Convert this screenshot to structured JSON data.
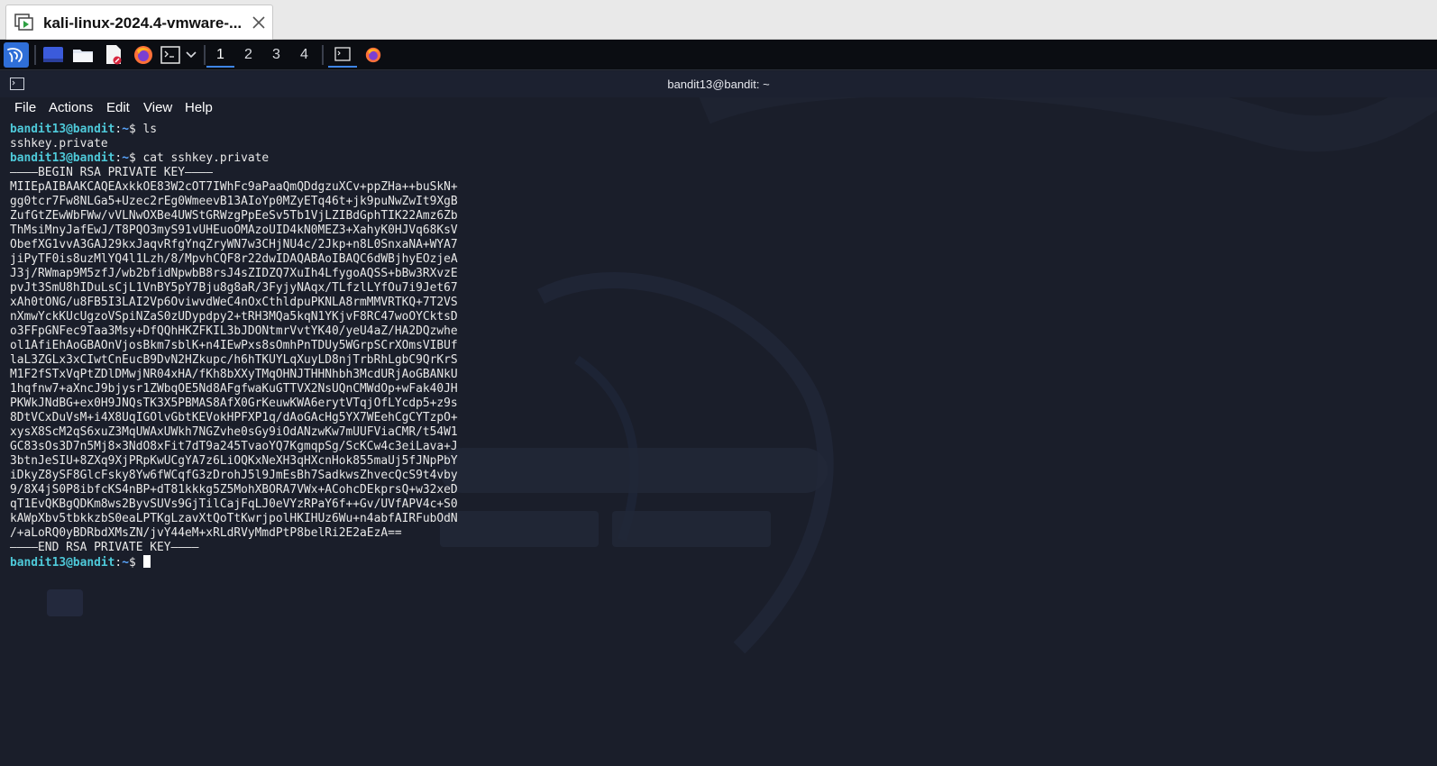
{
  "vmware": {
    "tab_title": "kali-linux-2024.4-vmware-...",
    "icons": [
      "vm-icon",
      "close-icon"
    ]
  },
  "panel": {
    "workspaces": [
      "1",
      "2",
      "3",
      "4"
    ],
    "active_workspace": "1",
    "icons": [
      "kali-menu-icon",
      "show-desktop-icon",
      "file-manager-icon",
      "text-editor-icon",
      "firefox-icon",
      "terminal-icon",
      "dropdown-icon",
      "terminal-task-icon",
      "firefox-task-icon"
    ]
  },
  "terminal": {
    "title": "bandit13@bandit: ~",
    "menu": [
      "File",
      "Actions",
      "Edit",
      "View",
      "Help"
    ],
    "prompt": {
      "user_host": "bandit13@bandit",
      "path": "~"
    },
    "lines": [
      {
        "type": "prompt",
        "cmd": " ls"
      },
      {
        "type": "out",
        "text": "sshkey.private"
      },
      {
        "type": "prompt",
        "cmd": " cat sshkey.private"
      },
      {
        "type": "out",
        "text": "————BEGIN RSA PRIVATE KEY————"
      },
      {
        "type": "out",
        "text": "MIIEpAIBAAKCAQEAxkkOE83W2cOT7IWhFc9aPaaQmQDdgzuXCv+ppZHa++buSkN+"
      },
      {
        "type": "out",
        "text": "gg0tcr7Fw8NLGa5+Uzec2rEg0WmeevB13AIoYp0MZyETq46t+jk9puNwZwIt9XgB"
      },
      {
        "type": "out",
        "text": "ZufGtZEwWbFWw/vVLNwOXBe4UWStGRWzgPpEeSv5Tb1VjLZIBdGphTIK22Amz6Zb"
      },
      {
        "type": "out",
        "text": "ThMsiMnyJafEwJ/T8PQO3myS91vUHEuoOMAzoUID4kN0MEZ3+XahyK0HJVq68KsV"
      },
      {
        "type": "out",
        "text": "ObefXG1vvA3GAJ29kxJaqvRfgYnqZryWN7w3CHjNU4c/2Jkp+n8L0SnxaNA+WYA7"
      },
      {
        "type": "out",
        "text": "jiPyTF0is8uzMlYQ4l1Lzh/8/MpvhCQF8r22dwIDAQABAoIBAQC6dWBjhyEOzjeA"
      },
      {
        "type": "out",
        "text": "J3j/RWmap9M5zfJ/wb2bfidNpwbB8rsJ4sZIDZQ7XuIh4LfygoAQSS+bBw3RXvzE"
      },
      {
        "type": "out",
        "text": "pvJt3SmU8hIDuLsCjL1VnBY5pY7Bju8g8aR/3FyjyNAqx/TLfzlLYfOu7i9Jet67"
      },
      {
        "type": "out",
        "text": "xAh0tONG/u8FB5I3LAI2Vp6OviwvdWeC4nOxCthldpuPKNLA8rmMMVRTKQ+7T2VS"
      },
      {
        "type": "out",
        "text": "nXmwYckKUcUgzoVSpiNZaS0zUDypdpy2+tRH3MQa5kqN1YKjvF8RC47woOYCktsD"
      },
      {
        "type": "out",
        "text": "o3FFpGNFec9Taa3Msy+DfQQhHKZFKIL3bJDONtmrVvtYK40/yeU4aZ/HA2DQzwhe"
      },
      {
        "type": "out",
        "text": "ol1AfiEhAoGBAOnVjosBkm7sblK+n4IEwPxs8sOmhPnTDUy5WGrpSCrXOmsVIBUf"
      },
      {
        "type": "out",
        "text": "laL3ZGLx3xCIwtCnEucB9DvN2HZkupc/h6hTKUYLqXuyLD8njTrbRhLgbC9QrKrS"
      },
      {
        "type": "out",
        "text": "M1F2fSTxVqPtZDlDMwjNR04xHA/fKh8bXXyTMqOHNJTHHNhbh3McdURjAoGBANkU"
      },
      {
        "type": "out",
        "text": "1hqfnw7+aXncJ9bjysr1ZWbqOE5Nd8AFgfwaKuGTTVX2NsUQnCMWdOp+wFak40JH"
      },
      {
        "type": "out",
        "text": "PKWkJNdBG+ex0H9JNQsTK3X5PBMAS8AfX0GrKeuwKWA6erytVTqjOfLYcdp5+z9s"
      },
      {
        "type": "out",
        "text": "8DtVCxDuVsM+i4X8UqIGOlvGbtKEVokHPFXP1q/dAoGAcHg5YX7WEehCgCYTzpO+"
      },
      {
        "type": "out",
        "text": "xysX8ScM2qS6xuZ3MqUWAxUWkh7NGZvhe0sGy9iOdANzwKw7mUUFViaCMR/t54W1"
      },
      {
        "type": "out",
        "text": "GC83sOs3D7n5Mj8×3NdO8xFit7dT9a245TvaoYQ7KgmqpSg/ScKCw4c3eiLava+J"
      },
      {
        "type": "out",
        "text": "3btnJeSIU+8ZXq9XjPRpKwUCgYA7z6LiOQKxNeXH3qHXcnHok855maUj5fJNpPbY"
      },
      {
        "type": "out",
        "text": "iDkyZ8ySF8GlcFsky8Yw6fWCqfG3zDrohJ5l9JmEsBh7SadkwsZhvecQcS9t4vby"
      },
      {
        "type": "out",
        "text": "9/8X4jS0P8ibfcKS4nBP+dT81kkkg5Z5MohXBORA7VWx+ACohcDEkprsQ+w32xeD"
      },
      {
        "type": "out",
        "text": "qT1EvQKBgQDKm8ws2ByvSUVs9GjTilCajFqLJ0eVYzRPaY6f++Gv/UVfAPV4c+S0"
      },
      {
        "type": "out",
        "text": "kAWpXbv5tbkkzbS0eaLPTKgLzavXtQoTtKwrjpolHKIHUz6Wu+n4abfAIRFubOdN"
      },
      {
        "type": "out",
        "text": "/+aLoRQ0yBDRbdXMsZN/jvY44eM+xRLdRVyMmdPtP8belRi2E2aEzA=="
      },
      {
        "type": "out",
        "text": "————END RSA PRIVATE KEY————"
      },
      {
        "type": "prompt-cursor",
        "cmd": " "
      }
    ]
  }
}
